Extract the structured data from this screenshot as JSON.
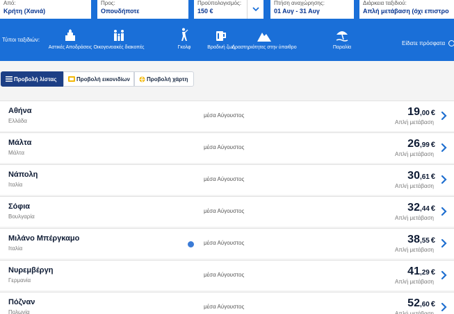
{
  "search": {
    "from": {
      "label": "Από:",
      "value": "Κρήτη (Χανιά)"
    },
    "to": {
      "label": "Προς:",
      "value": "Οπουδήποτε"
    },
    "budget": {
      "label": "Προϋπολογισμός:",
      "value": "150 €"
    },
    "dates": {
      "label": "Πτήση αναχώρησης:",
      "value": "01 Αυγ - 31 Αυγ"
    },
    "duration": {
      "label": "Διάρκεια ταξιδιού:",
      "value": "Απλή μετάβαση (όχι επιστρο"
    }
  },
  "trip_types": {
    "label": "Τύποι ταξιδιών:",
    "items": [
      {
        "label": "Αστικές Αποδράσεις",
        "icon": "city-icon"
      },
      {
        "label": "Οικογενειακές διακοπές",
        "icon": "family-icon"
      },
      {
        "label": "Γκολφ",
        "icon": "golf-icon"
      },
      {
        "label": "Βραδινή ζωή",
        "icon": "nightlife-icon"
      },
      {
        "label": "Δραστηριότητες στην ύπαιθρο",
        "icon": "mountain-icon"
      },
      {
        "label": "Παραλία",
        "icon": "beach-icon"
      }
    ],
    "recent_label": "Είδατε πρόσφατα"
  },
  "views": {
    "list": "Προβολή λίστας",
    "icons": "Προβολή εικονιδίων",
    "map": "Προβολή χάρτη"
  },
  "results": [
    {
      "city": "Αθήνα",
      "country": "Ελλάδα",
      "period": "μέσα Αύγουστος",
      "price_int": "19",
      "price_dec": ",00",
      "currency": "€",
      "type": "Απλή μετάβαση"
    },
    {
      "city": "Μάλτα",
      "country": "Μάλτα",
      "period": "μέσα Αύγουστος",
      "price_int": "26",
      "price_dec": ",99",
      "currency": "€",
      "type": "Απλή μετάβαση"
    },
    {
      "city": "Νάπολη",
      "country": "Ιταλία",
      "period": "μέσα Αύγουστος",
      "price_int": "30",
      "price_dec": ",61",
      "currency": "€",
      "type": "Απλή μετάβαση"
    },
    {
      "city": "Σόφια",
      "country": "Βουλγαρία",
      "period": "μέσα Αύγουστος",
      "price_int": "32",
      "price_dec": ",44",
      "currency": "€",
      "type": "Απλή μετάβαση"
    },
    {
      "city": "Μιλάνο Μπέργκαμο",
      "country": "Ιταλία",
      "period": "μέσα Αύγουστος",
      "price_int": "38",
      "price_dec": ",55",
      "currency": "€",
      "type": "Απλή μετάβαση",
      "info": true
    },
    {
      "city": "Νυρεμβέργη",
      "country": "Γερμανία",
      "period": "μέσα Αύγουστος",
      "price_int": "41",
      "price_dec": ",29",
      "currency": "€",
      "type": "Απλή μετάβαση"
    },
    {
      "city": "Πόζναν",
      "country": "Πολωνία",
      "period": "μέσα Αύγουστος",
      "price_int": "52",
      "price_dec": ",60",
      "currency": "€",
      "type": "Απλή μετάβαση"
    }
  ],
  "colors": {
    "header": "#1a6fd8",
    "field_text": "#073590",
    "active_view": "#1d3f85",
    "accent_arrow": "#1f6fd0"
  }
}
